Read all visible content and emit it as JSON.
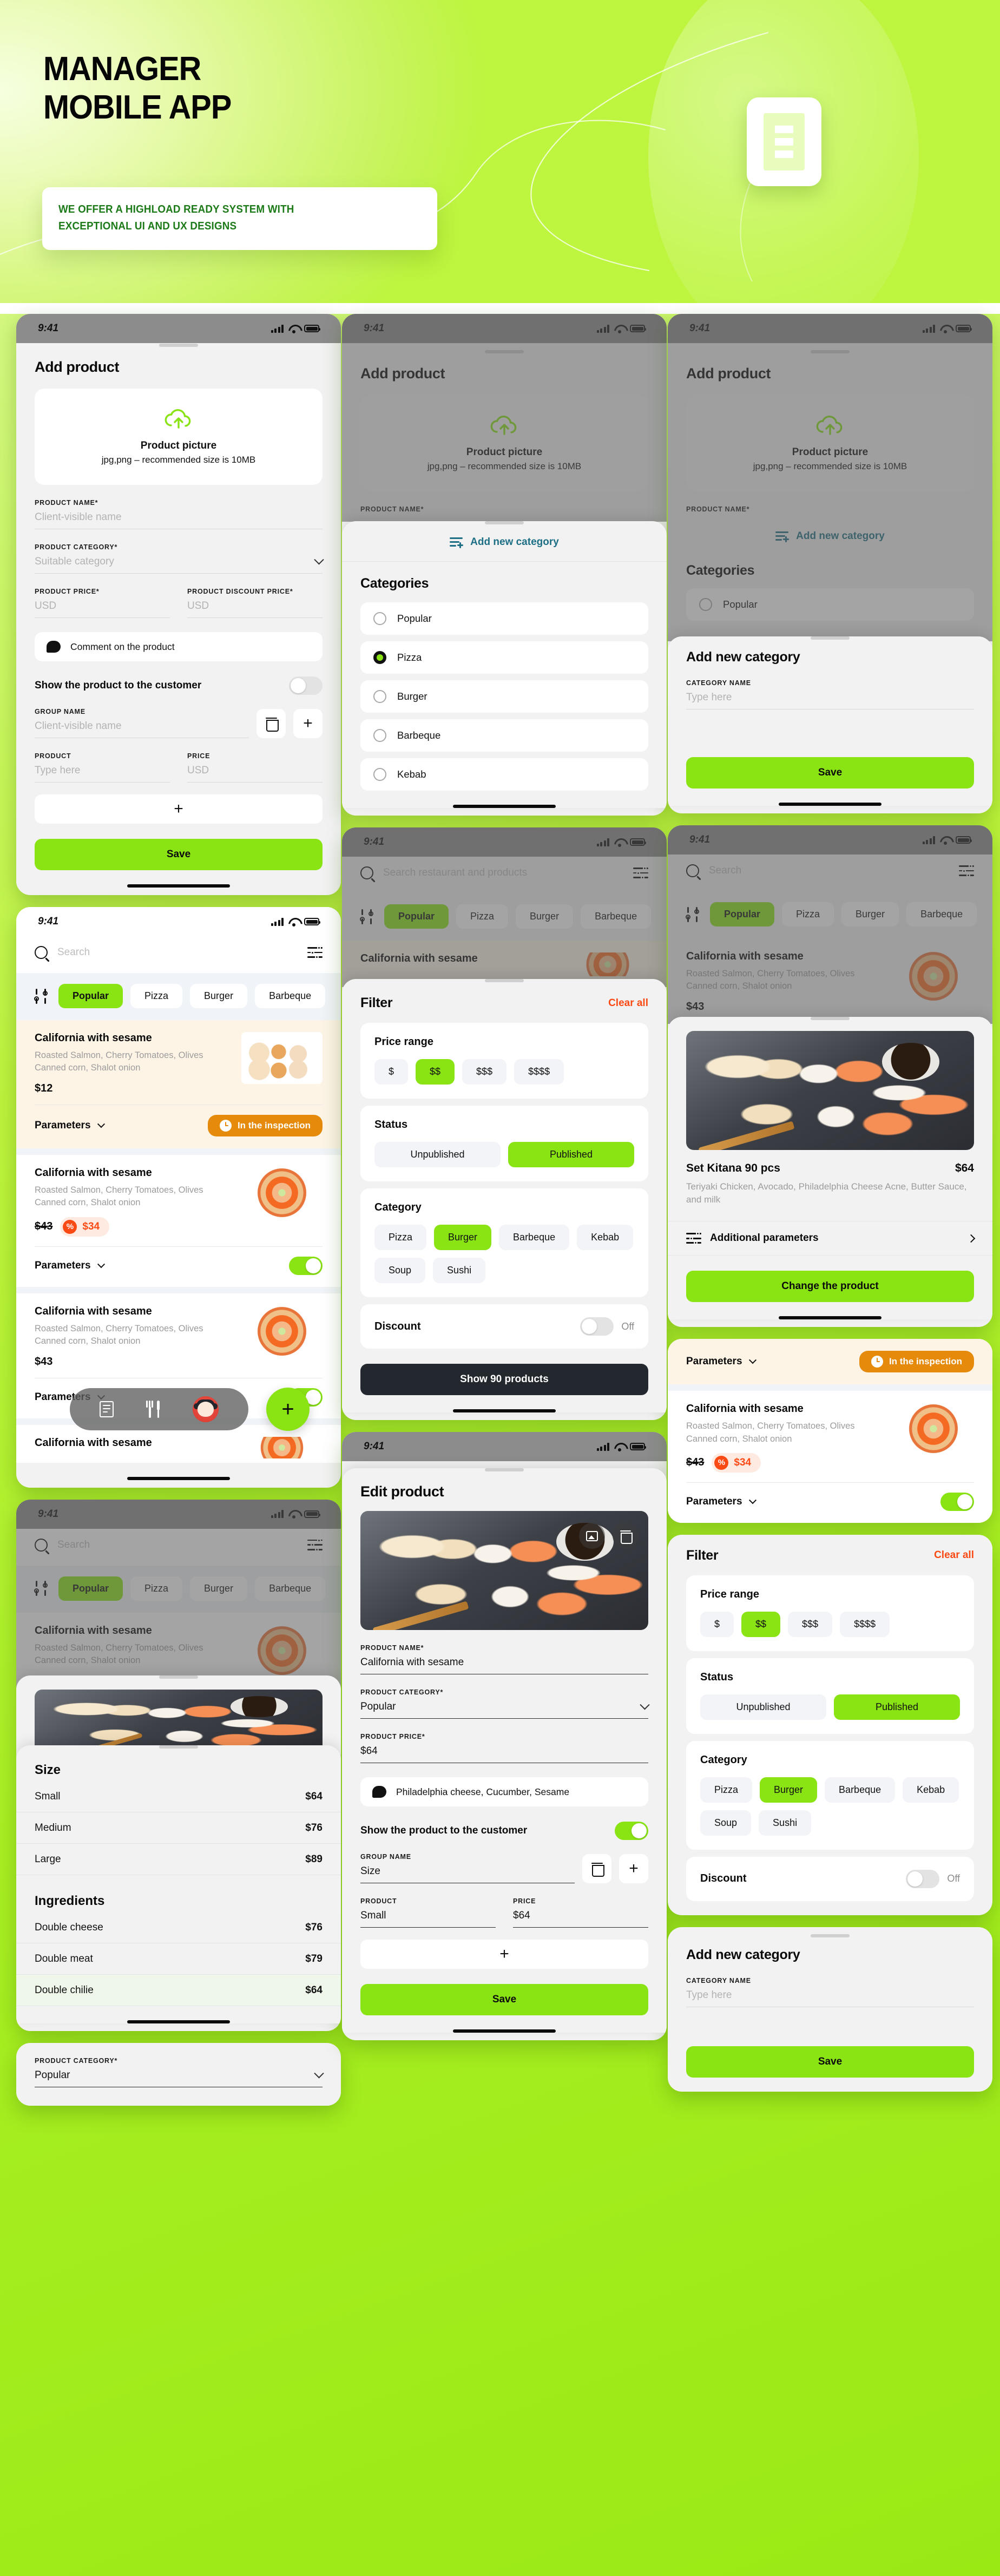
{
  "hero": {
    "title_line1": "MANAGER",
    "title_line2": "MOBILE APP",
    "subtitle_line1": "WE OFFER A HIGHLOAD READY SYSTEM WITH",
    "subtitle_line2": "EXCEPTIONAL UI AND UX DESIGNS",
    "accent_green": "#9ded15",
    "subtitle_color": "#1d7a18"
  },
  "status_bar": {
    "time": "9:41"
  },
  "add_product": {
    "title": "Add product",
    "upload": {
      "title": "Product picture",
      "subtitle": "jpg,png – recommended size is 10MB"
    },
    "name_label": "PRODUCT NAME*",
    "name_placeholder": "Client-visible name",
    "category_label": "PRODUCT CATEGORY*",
    "category_placeholder": "Suitable category",
    "price_label": "PRODUCT PRICE*",
    "price_placeholder": "USD",
    "discount_label": "PRODUCT DISCOUNT PRICE*",
    "discount_placeholder": "USD",
    "comment": "Comment on the product",
    "show_toggle_label": "Show the product to the customer",
    "group_label": "GROUP NAME",
    "group_placeholder": "Client-visible name",
    "sub_product_label": "PRODUCT",
    "sub_product_placeholder": "Type here",
    "sub_price_label": "PRICE",
    "sub_price_placeholder": "USD",
    "save_label": "Save"
  },
  "categories_sheet": {
    "add_new_link": "Add new category",
    "heading": "Categories",
    "items": [
      {
        "label": "Popular",
        "selected": false
      },
      {
        "label": "Pizza",
        "selected": true
      },
      {
        "label": "Burger",
        "selected": false
      },
      {
        "label": "Barbeque",
        "selected": false
      },
      {
        "label": "Kebab",
        "selected": false
      }
    ]
  },
  "add_category_sheet": {
    "title": "Add new category",
    "name_label": "CATEGORY NAME",
    "name_placeholder": "Type here",
    "save_label": "Save"
  },
  "search": {
    "placeholder_long": "Search restaurant and products",
    "placeholder_short": "Search",
    "chips": [
      "Popular",
      "Pizza",
      "Burger",
      "Barbeque"
    ],
    "active_chip": "Popular"
  },
  "products": [
    {
      "name": "California with sesame",
      "desc": "Roasted Salmon, Cherry Tomatoes, Olives Canned corn, Shalot onion",
      "price": "$12",
      "old_price": "",
      "discount_price": "",
      "params_label": "Parameters",
      "status_badge": "In the inspection",
      "has_toggle": false,
      "toggle_on": false,
      "art": "sushi"
    },
    {
      "name": "California with sesame",
      "desc": "Roasted Salmon, Cherry Tomatoes, Olives Canned corn, Shalot onion",
      "price": "",
      "old_price": "$43",
      "discount_price": "$34",
      "params_label": "Parameters",
      "status_badge": "",
      "has_toggle": true,
      "toggle_on": true,
      "art": "round"
    },
    {
      "name": "California with sesame",
      "desc": "Roasted Salmon, Cherry Tomatoes, Olives Canned corn, Shalot onion",
      "price": "$43",
      "old_price": "",
      "discount_price": "",
      "params_label": "Parameters",
      "status_badge": "",
      "has_toggle": true,
      "toggle_on": true,
      "art": "round"
    }
  ],
  "filter": {
    "title": "Filter",
    "clear_all": "Clear all",
    "price_range_title": "Price range",
    "price_options": [
      "$",
      "$$",
      "$$$",
      "$$$$"
    ],
    "price_selected": "$$",
    "status_title": "Status",
    "status_options": [
      "Unpublished",
      "Published"
    ],
    "status_selected": "Published",
    "category_title": "Category",
    "category_options": [
      "Pizza",
      "Burger",
      "Barbeque",
      "Kebab",
      "Soup",
      "Sushi"
    ],
    "category_selected": "Burger",
    "discount_title": "Discount",
    "discount_state": "Off",
    "show_button": "Show 90 products"
  },
  "product_detail": {
    "name": "Set Kitana 90 pcs",
    "price": "$64",
    "desc": "Teriyaki Chicken, Avocado, Philadelphia Cheese Acne, Butter Sauce, and milk",
    "additional_params": "Additional parameters",
    "change_button": "Change the product"
  },
  "edit_product": {
    "title": "Edit product",
    "name_label": "PRODUCT NAME*",
    "name_value": "California with sesame",
    "category_label": "PRODUCT CATEGORY*",
    "category_value": "Popular",
    "price_label": "PRODUCT PRICE*",
    "price_value": "$64",
    "comment": "Philadelphia cheese, Cucumber, Sesame",
    "show_toggle_label": "Show the product to the customer",
    "group_label": "GROUP NAME",
    "group_value": "Size",
    "sub_product_label": "PRODUCT",
    "sub_product_value": "Small",
    "sub_price_label": "PRICE",
    "sub_price_value": "$64",
    "save_label": "Save"
  },
  "options_sheet": {
    "size_title": "Size",
    "sizes": [
      {
        "name": "Small",
        "price": "$64"
      },
      {
        "name": "Medium",
        "price": "$76"
      },
      {
        "name": "Large",
        "price": "$89"
      }
    ],
    "ingredients_title": "Ingredients",
    "ingredients": [
      {
        "name": "Double cheese",
        "price": "$76"
      },
      {
        "name": "Double meat",
        "price": "$79"
      },
      {
        "name": "Double chilie",
        "price": "$64"
      }
    ],
    "footer_category_label": "PRODUCT CATEGORY*",
    "footer_category_value": "Popular"
  }
}
